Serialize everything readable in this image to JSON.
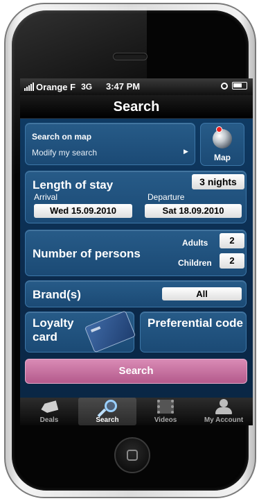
{
  "status": {
    "carrier": "Orange F",
    "network": "3G",
    "time": "3:47 PM"
  },
  "navbar": {
    "title": "Search"
  },
  "map_panel": {
    "title": "Search on map",
    "subtitle": "Modify my search",
    "map_button_label": "Map"
  },
  "stay": {
    "title": "Length of stay",
    "nights": "3 nights",
    "arrival_label": "Arrival",
    "arrival_value": "Wed 15.09.2010",
    "departure_label": "Departure",
    "departure_value": "Sat 18.09.2010"
  },
  "persons": {
    "title": "Number of persons",
    "adults_label": "Adults",
    "adults_value": "2",
    "children_label": "Children",
    "children_value": "2"
  },
  "brand": {
    "title": "Brand(s)",
    "value": "All"
  },
  "loyalty": {
    "title": "Loyalty card"
  },
  "preferential": {
    "title": "Preferential code"
  },
  "search_button": {
    "label": "Search"
  },
  "tabs": [
    {
      "label": "Deals",
      "icon": "tag-icon"
    },
    {
      "label": "Search",
      "icon": "magnifier-icon",
      "active": true
    },
    {
      "label": "Videos",
      "icon": "film-icon"
    },
    {
      "label": "My Account",
      "icon": "person-icon"
    }
  ],
  "colors": {
    "background": "#0b2a4c",
    "panel": "#275b88",
    "search_button": "#c56e9f"
  }
}
